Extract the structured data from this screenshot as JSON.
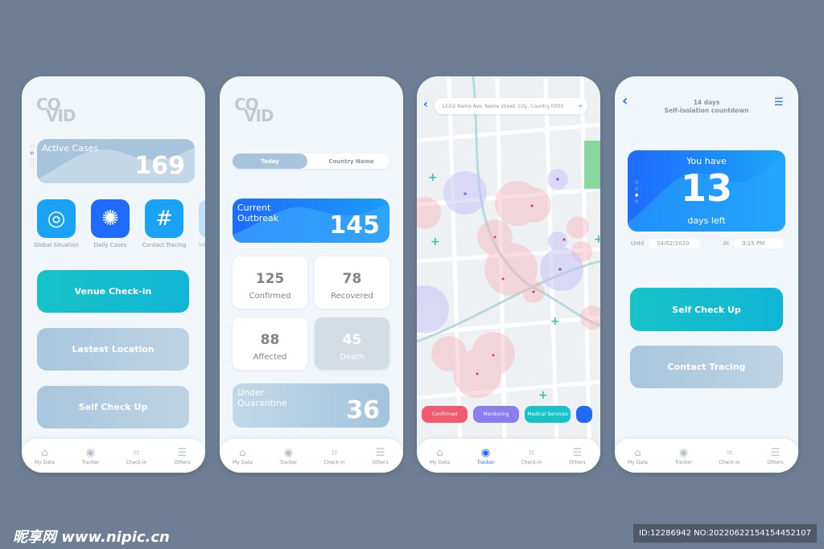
{
  "colors": {
    "background": "#6e7f95",
    "primary": "#1f6bff",
    "teal": "#17c3c8",
    "muted": "#a8c6de",
    "confirmed": "#f25a70",
    "monitoring": "#8b7cf0",
    "medical": "#17c3c8"
  },
  "logo": {
    "line1": "CO",
    "line2": "VID"
  },
  "nav": [
    {
      "label": "My Data",
      "icon": "home-icon"
    },
    {
      "label": "Tracker",
      "icon": "target-icon"
    },
    {
      "label": "Check-in",
      "icon": "scan-icon"
    },
    {
      "label": "Others",
      "icon": "menu-icon"
    }
  ],
  "screen1": {
    "active_label": "Active Cases",
    "active_value": "169",
    "carousel_active": 2,
    "shortcuts": [
      {
        "label": "Global Situation",
        "icon": "globe-icon"
      },
      {
        "label": "Daily Cases",
        "icon": "virus-icon"
      },
      {
        "label": "Contact Tracing",
        "icon": "hash-icon"
      },
      {
        "label": "Inform",
        "icon": "info-icon"
      }
    ],
    "buttons": [
      "Venue Check-in",
      "Lastest Location",
      "Self Check Up"
    ]
  },
  "screen2": {
    "toggle": [
      "Today",
      "Country Name"
    ],
    "outbreak_label": "Current Outbreak",
    "outbreak_value": "145",
    "stats": [
      {
        "value": "125",
        "label": "Confirmed"
      },
      {
        "value": "78",
        "label": "Recovered"
      },
      {
        "value": "88",
        "label": "Affected"
      },
      {
        "value": "45",
        "label": "Death"
      }
    ],
    "quarantine_label": "Under Quarantine",
    "quarantine_value": "36"
  },
  "screen3": {
    "address": "123/2 Name Ave. Name street, City, Country,0000",
    "chips": [
      "Confirmed",
      "Monitoring",
      "Medical Services"
    ],
    "active_nav": "Tracker"
  },
  "screen4": {
    "title": "14 days",
    "subtitle": "Self-isolation countdown",
    "you_have": "You have",
    "days": "13",
    "days_left": "days left",
    "until_label": "Until",
    "until_value": "04/02/2020",
    "at_label": "At",
    "at_value": "3:25 PM",
    "carousel_active": 3,
    "buttons": [
      "Self Check Up",
      "Contact Tracing"
    ]
  },
  "watermark": {
    "site": "昵享网 www.nipic.cn",
    "id": "ID:12286942 NO:20220622154154452107"
  }
}
